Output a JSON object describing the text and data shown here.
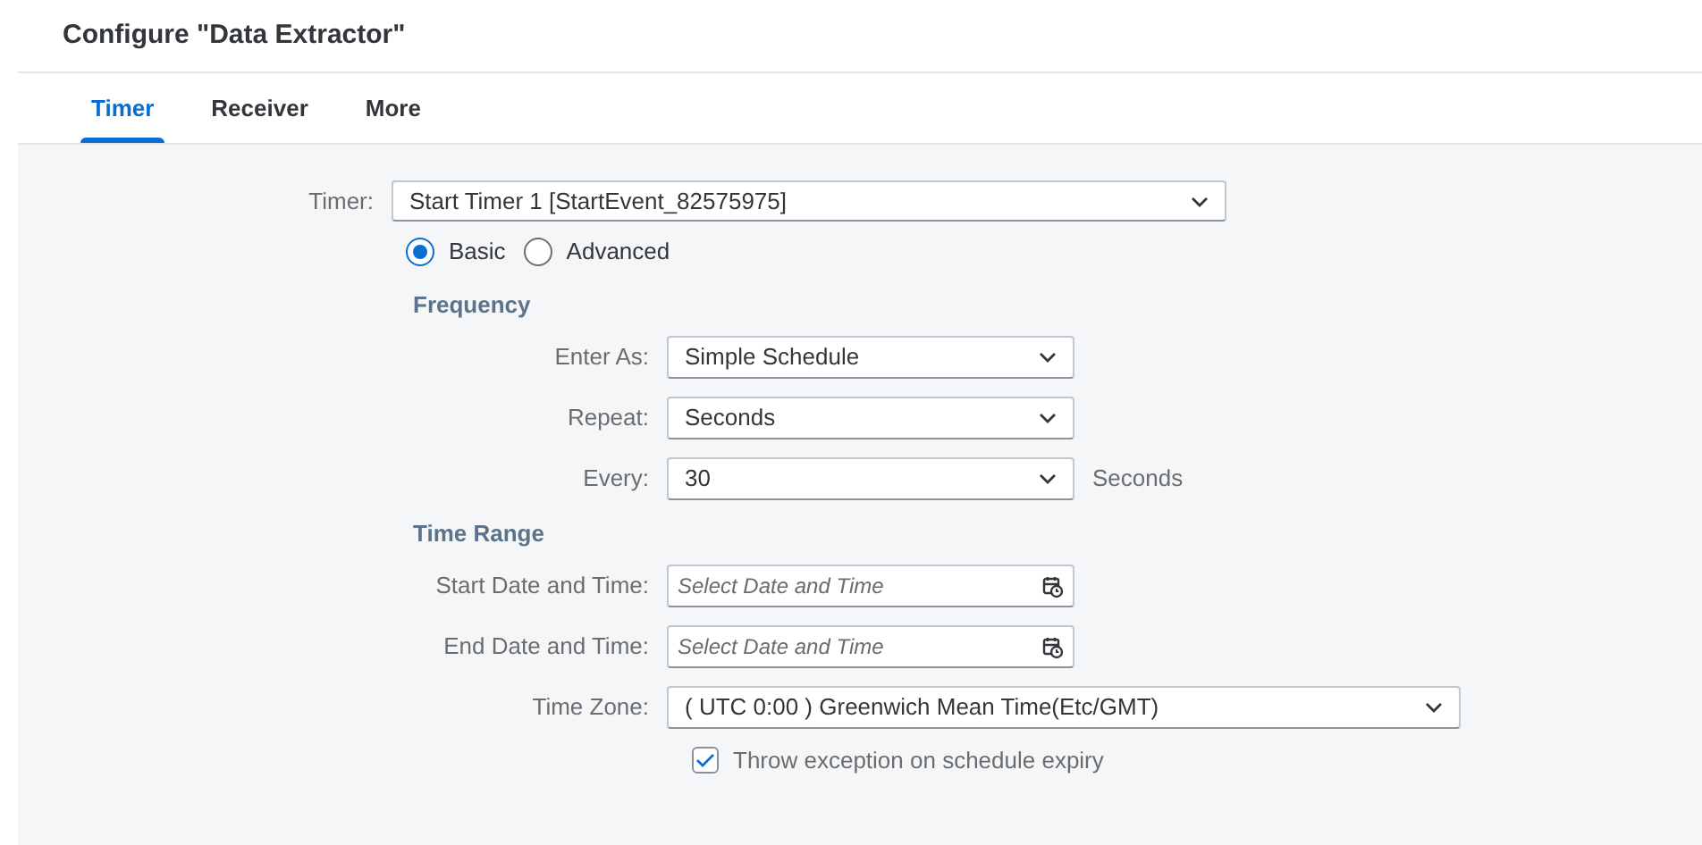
{
  "title": "Configure \"Data Extractor\"",
  "tabs": [
    {
      "label": "Timer",
      "selected": true
    },
    {
      "label": "Receiver",
      "selected": false
    },
    {
      "label": "More",
      "selected": false
    }
  ],
  "timer": {
    "label": "Timer:",
    "value": "Start Timer 1 [StartEvent_82575975]"
  },
  "mode_options": [
    {
      "label": "Basic",
      "selected": true
    },
    {
      "label": "Advanced",
      "selected": false
    }
  ],
  "frequency": {
    "heading": "Frequency",
    "fields": [
      {
        "kind": "select",
        "label": "Enter As:",
        "value": "Simple Schedule"
      },
      {
        "kind": "select",
        "label": "Repeat:",
        "value": "Seconds"
      },
      {
        "kind": "select",
        "label": "Every:",
        "value": "30",
        "unit": "Seconds"
      }
    ]
  },
  "time_range": {
    "heading": "Time Range",
    "fields": [
      {
        "kind": "date",
        "label": "Start Date and Time:",
        "placeholder": "Select Date and Time"
      },
      {
        "kind": "date",
        "label": "End Date and Time:",
        "placeholder": "Select Date and Time"
      }
    ]
  },
  "time_zone": {
    "label": "Time Zone:",
    "value": "( UTC 0:00 ) Greenwich Mean Time(Etc/GMT)"
  },
  "throw_exception": {
    "label": "Throw exception on schedule expiry",
    "checked": true
  }
}
